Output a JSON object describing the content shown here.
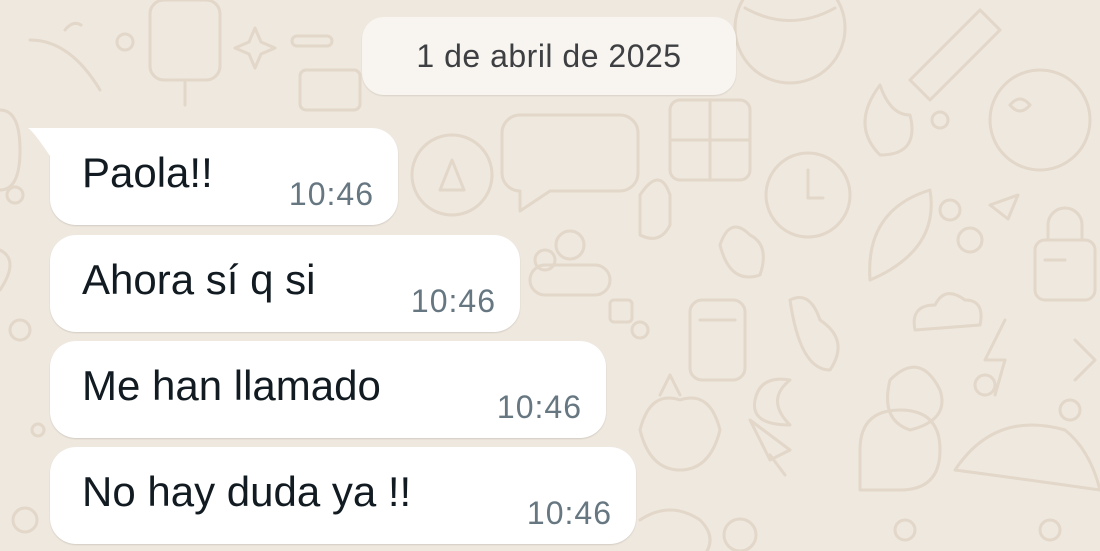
{
  "conversation": {
    "date_separator": "1 de abril de 2025",
    "messages": [
      {
        "text": "Paola!!",
        "time": "10:46",
        "direction": "incoming"
      },
      {
        "text": "Ahora sí q si",
        "time": "10:46",
        "direction": "incoming"
      },
      {
        "text": "Me han llamado",
        "time": "10:46",
        "direction": "incoming"
      },
      {
        "text": "No hay duda ya !!",
        "time": "10:46",
        "direction": "incoming"
      }
    ]
  },
  "theme": {
    "wallpaper_color": "#efe8de",
    "doodle_color": "#e2d7c8",
    "bubble_color": "#ffffff",
    "text_color": "#111b21",
    "time_color": "#667781",
    "date_chip_color": "#f8f5f0"
  }
}
